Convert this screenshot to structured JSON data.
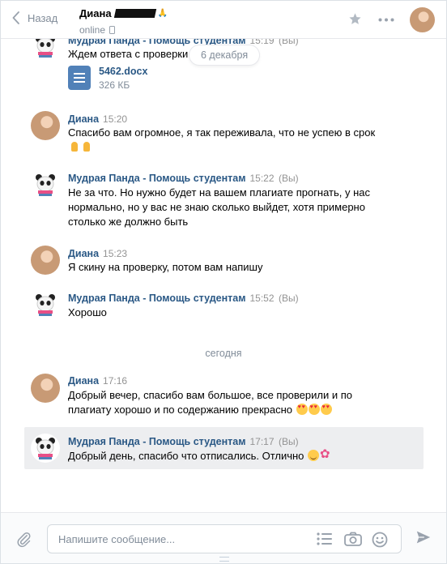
{
  "header": {
    "back_label": "Назад",
    "peer_name": "Диана",
    "peer_status": "online"
  },
  "date_pill": "6 декабря",
  "today_label": "сегодня",
  "messages": [
    {
      "author": "Мудрая Панда - Помощь студентам",
      "time": "15:19",
      "suffix": "(Вы)",
      "text": "Ждем ответа с проверки",
      "doc": {
        "name": "5462.docx",
        "size": "326 КБ"
      }
    },
    {
      "author": "Диана",
      "time": "15:20",
      "suffix": "",
      "text": "Спасибо вам огромное, я так переживала, что не успею в срок"
    },
    {
      "author": "Мудрая Панда - Помощь студентам",
      "time": "15:22",
      "suffix": "(Вы)",
      "text": "Не за что. Но нужно будет на вашем плагиате прогнать, у нас нормально, но у вас не знаю сколько выйдет, хотя примерно столько же должно быть"
    },
    {
      "author": "Диана",
      "time": "15:23",
      "suffix": "",
      "text": "Я скину на проверку, потом вам напишу"
    },
    {
      "author": "Мудрая Панда - Помощь студентам",
      "time": "15:52",
      "suffix": "(Вы)",
      "text": "Хорошо"
    },
    {
      "author": "Диана",
      "time": "17:16",
      "suffix": "",
      "text": "Добрый вечер, спасибо вам большое, все проверили и по плагиату хорошо и по содержанию прекрасно"
    },
    {
      "author": "Мудрая Панда - Помощь студентам",
      "time": "17:17",
      "suffix": "(Вы)",
      "text": "Добрый день, спасибо что отписались. Отлично"
    }
  ],
  "composer": {
    "placeholder": "Напишите сообщение..."
  },
  "icons": [
    "back-chevron-icon",
    "star-icon",
    "more-icon",
    "phone-icon",
    "document-icon",
    "attach-icon",
    "template-list-icon",
    "camera-icon",
    "emoji-icon",
    "send-icon"
  ],
  "colors": {
    "link": "#2a5885",
    "muted": "#818c99",
    "selected": "#edeef0",
    "doc": "#5181b8"
  }
}
